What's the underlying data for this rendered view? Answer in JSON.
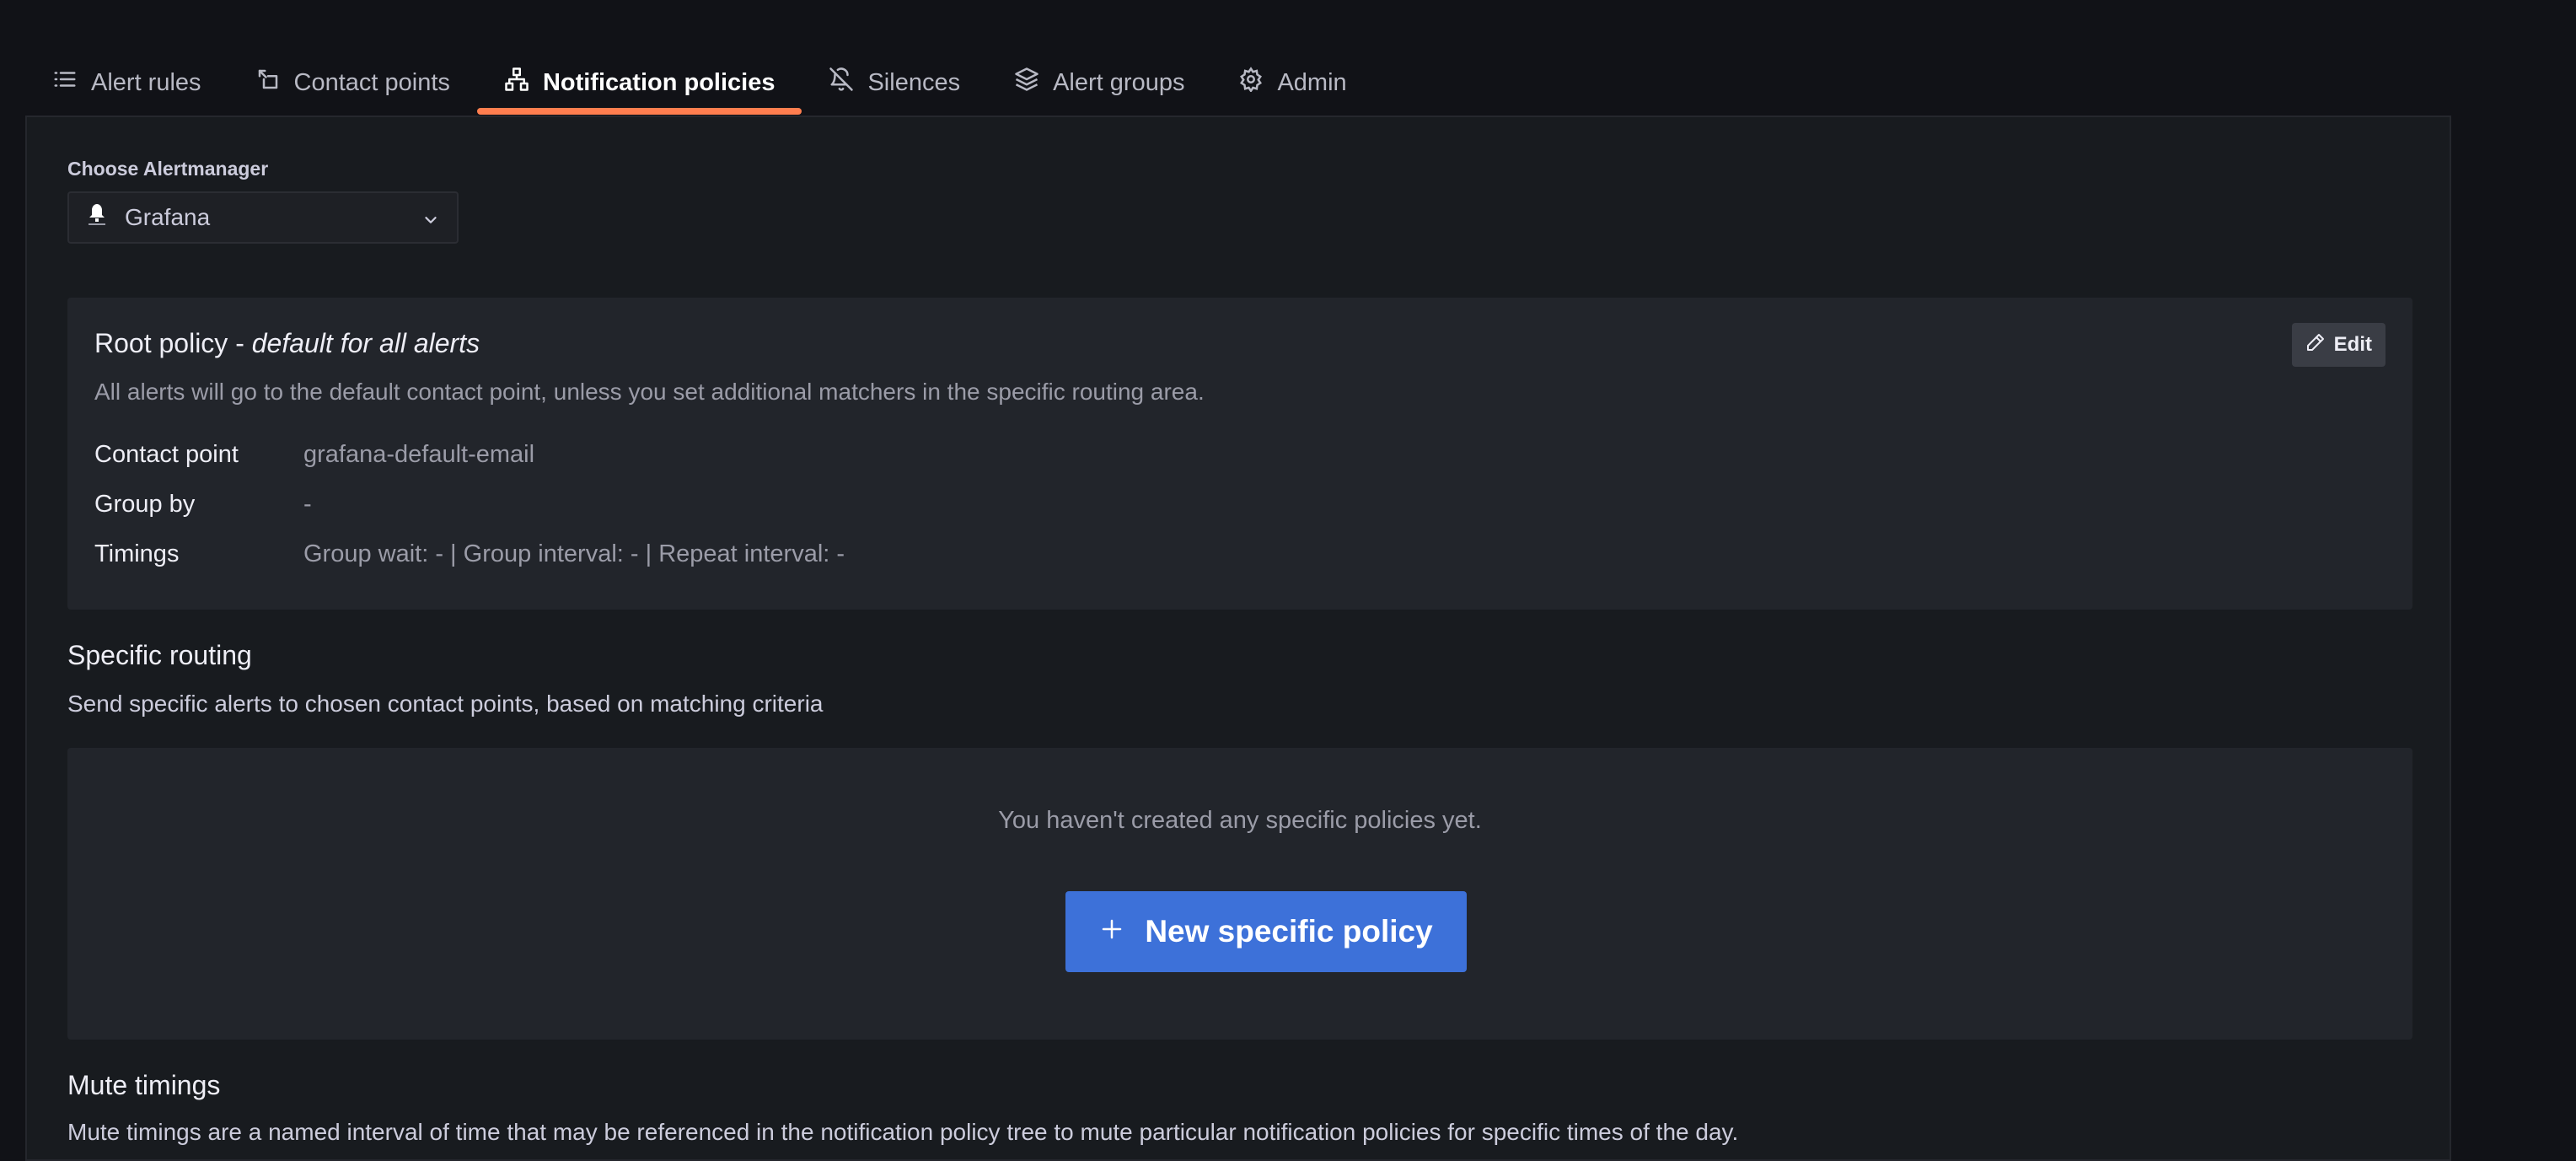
{
  "tabs": [
    {
      "label": "Alert rules",
      "icon": "list-icon",
      "active": false
    },
    {
      "label": "Contact points",
      "icon": "contact-icon",
      "active": false
    },
    {
      "label": "Notification policies",
      "icon": "sitemap-icon",
      "active": true
    },
    {
      "label": "Silences",
      "icon": "bell-slash-icon",
      "active": false
    },
    {
      "label": "Alert groups",
      "icon": "layers-icon",
      "active": false
    },
    {
      "label": "Admin",
      "icon": "gear-icon",
      "active": false
    }
  ],
  "alertmanager": {
    "label": "Choose Alertmanager",
    "selected": "Grafana"
  },
  "root_policy": {
    "title_prefix": "Root policy - ",
    "title_suffix": "default for all alerts",
    "description": "All alerts will go to the default contact point, unless you set additional matchers in the specific routing area.",
    "edit_label": "Edit",
    "fields": [
      {
        "key": "Contact point",
        "value": "grafana-default-email"
      },
      {
        "key": "Group by",
        "value": "-"
      },
      {
        "key": "Timings",
        "value": "Group wait: - | Group interval: - | Repeat interval: -"
      }
    ]
  },
  "specific_routing": {
    "title": "Specific routing",
    "description": "Send specific alerts to chosen contact points, based on matching criteria",
    "empty_text": "You haven't created any specific policies yet.",
    "new_button_label": "New specific policy"
  },
  "mute_timings": {
    "title": "Mute timings",
    "description": "Mute timings are a named interval of time that may be referenced in the notification policy tree to mute particular notification policies for specific times of the day."
  },
  "colors": {
    "accent_underline": "#ff7e4f",
    "primary_button": "#3d71d9",
    "background": "#111217",
    "panel": "#181b1f"
  }
}
